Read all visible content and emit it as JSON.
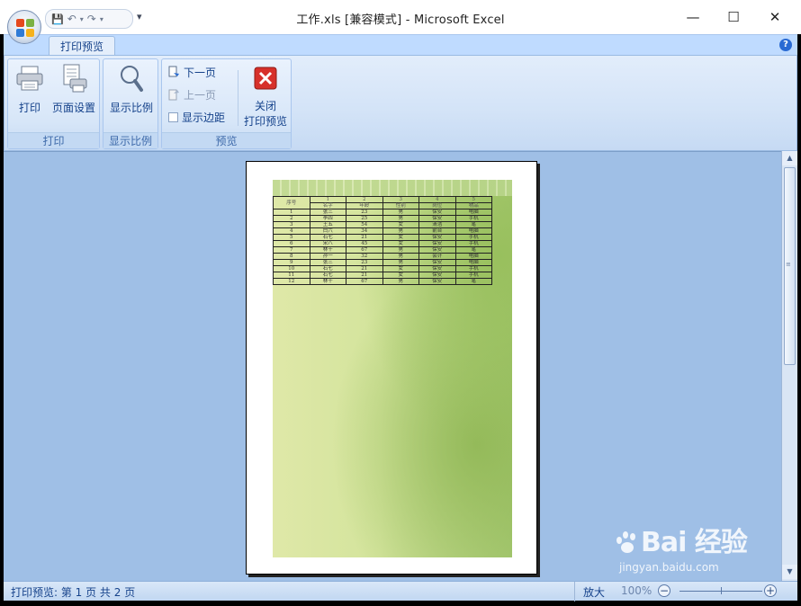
{
  "window": {
    "title": "工作.xls  [兼容模式] - Microsoft Excel",
    "controls": {
      "minimize": "—",
      "maximize": "☐",
      "close": "✕"
    }
  },
  "quick_access": {
    "save": "💾",
    "undo": "↶",
    "redo": "↷",
    "more": "▾"
  },
  "ribbon": {
    "active_tab": "打印预览",
    "groups": {
      "print": {
        "label": "打印",
        "print_button": "打印",
        "page_setup_button": "页面设置"
      },
      "zoom": {
        "label": "显示比例",
        "zoom_button": "显示比例"
      },
      "preview": {
        "label": "预览",
        "next_page": "下一页",
        "prev_page": "上一页",
        "show_margins": "显示边距",
        "close_line1": "关闭",
        "close_line2": "打印预览"
      }
    }
  },
  "sheet": {
    "col_numbers": [
      "1",
      "2",
      "3",
      "4",
      "5"
    ],
    "header_first": "序号",
    "headers": [
      "名字",
      "年龄",
      "性别",
      "岗位",
      "物品"
    ],
    "rows": [
      [
        "1",
        "张三",
        "23",
        "男",
        "保安",
        "电脑"
      ],
      [
        "2",
        "李四",
        "25",
        "男",
        "保安",
        "手机"
      ],
      [
        "3",
        "王五",
        "54",
        "女",
        "清洁",
        "笔"
      ],
      [
        "4",
        "白六",
        "34",
        "男",
        "前台",
        "电脑"
      ],
      [
        "5",
        "石七",
        "21",
        "女",
        "保安",
        "手机"
      ],
      [
        "6",
        "宋八",
        "45",
        "女",
        "保安",
        "手机"
      ],
      [
        "7",
        "林十",
        "67",
        "男",
        "保安",
        "笔"
      ],
      [
        "8",
        "孙一",
        "32",
        "男",
        "会计",
        "电脑"
      ],
      [
        "9",
        "张三",
        "23",
        "男",
        "保安",
        "电脑"
      ],
      [
        "10",
        "石七",
        "21",
        "女",
        "保安",
        "手机"
      ],
      [
        "11",
        "石七",
        "21",
        "女",
        "保安",
        "手机"
      ],
      [
        "12",
        "林十",
        "67",
        "男",
        "保安",
        "笔"
      ]
    ]
  },
  "status": {
    "text": "打印预览: 第 1 页  共 2 页",
    "zoom_label": "放大",
    "zoom_percent": "100%",
    "zoom_minus": "−",
    "zoom_plus": "+"
  },
  "watermark": {
    "brand": "Bai  经验",
    "url": "jingyan.baidu.com"
  },
  "colors": {
    "ribbon_bg": "#d3e3f7",
    "workspace_bg": "#9fbfe6",
    "accent": "#15428b",
    "close_icon": "#d7302a"
  }
}
